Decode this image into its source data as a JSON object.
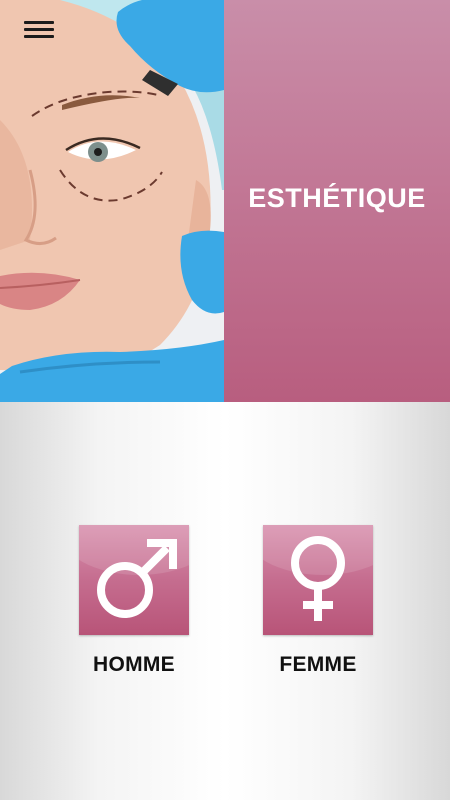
{
  "header": {
    "menu_icon": "hamburger-menu-icon",
    "title": "ESTHÉTIQUE",
    "hero_image": "woman-face-cosmetic-surgery-markings"
  },
  "gender_selection": {
    "options": [
      {
        "label": "HOMME",
        "icon": "male-symbol-icon"
      },
      {
        "label": "FEMME",
        "icon": "female-symbol-icon"
      }
    ]
  },
  "colors": {
    "accent": "#c27896",
    "accent_dark": "#b85478",
    "text": "#111111",
    "glove": "#3aa9e6"
  }
}
